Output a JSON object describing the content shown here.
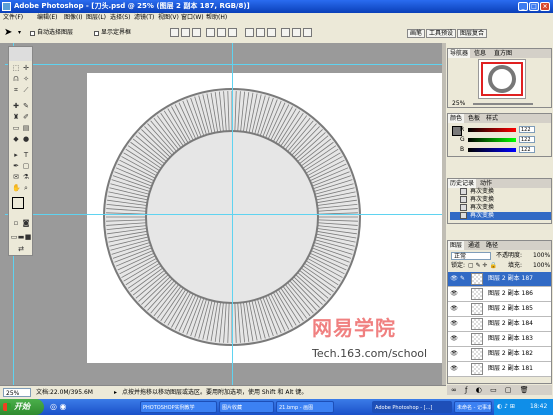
{
  "window": {
    "title": "Adobe Photoshop - [刀头.psd @ 25% (图层 2 副本 187, RGB/8)]"
  },
  "menu": [
    "文件(F)",
    "编辑(E)",
    "图像(I)",
    "图层(L)",
    "选择(S)",
    "滤镜(T)",
    "视图(V)",
    "窗口(W)",
    "帮助(H)"
  ],
  "options": {
    "auto_select": "自动选择图层",
    "show_bounds": "显示定界框"
  },
  "dock_tabs": [
    "画笔",
    "工具预设",
    "图层复合"
  ],
  "navigator": {
    "tabs": [
      "导航器",
      "信息",
      "直方图"
    ],
    "zoom": "25%"
  },
  "color": {
    "tabs": [
      "颜色",
      "色板",
      "样式"
    ],
    "channels": [
      {
        "label": "R",
        "value": "122"
      },
      {
        "label": "G",
        "value": "122"
      },
      {
        "label": "B",
        "value": "122"
      }
    ],
    "fg": "#7a7a7a"
  },
  "history": {
    "tabs": [
      "历史记录",
      "动作"
    ],
    "items": [
      "再次变换",
      "再次变换",
      "再次变换",
      "再次变换"
    ],
    "selected_index": 3
  },
  "layers": {
    "tabs": [
      "图层",
      "通道",
      "路径"
    ],
    "blend_mode": "正常",
    "opacity_label": "不透明度:",
    "opacity": "100%",
    "lock_label": "锁定:",
    "fill_label": "填充:",
    "fill": "100%",
    "items": [
      "图层 2 副本 187",
      "图层 2 副本 186",
      "图层 2 副本 185",
      "图层 2 副本 184",
      "图层 2 副本 183",
      "图层 2 副本 182",
      "图层 2 副本 181"
    ],
    "selected_index": 0
  },
  "status": {
    "zoom": "25%",
    "doc": "文档:22.0M/395.6M",
    "hint": "点按并拖移以移动图层或选区。要用附加选项，使用 Shift 和 Alt 键。"
  },
  "watermark": {
    "main": "网易学院",
    "url": "Tech.163.com/school"
  },
  "taskbar": {
    "start": "开始",
    "tasks": [
      "PHOTOSHOP实例教学",
      "图片收藏",
      "21.bmp - 画图",
      "Adobe Photoshop - [...]",
      "未命名 - 记事本"
    ],
    "active_index": 3,
    "clock": "18:42"
  },
  "wheel": {
    "tooth_count": 188,
    "fill": "#e6e6e6",
    "stroke": "#7a7a7a"
  }
}
